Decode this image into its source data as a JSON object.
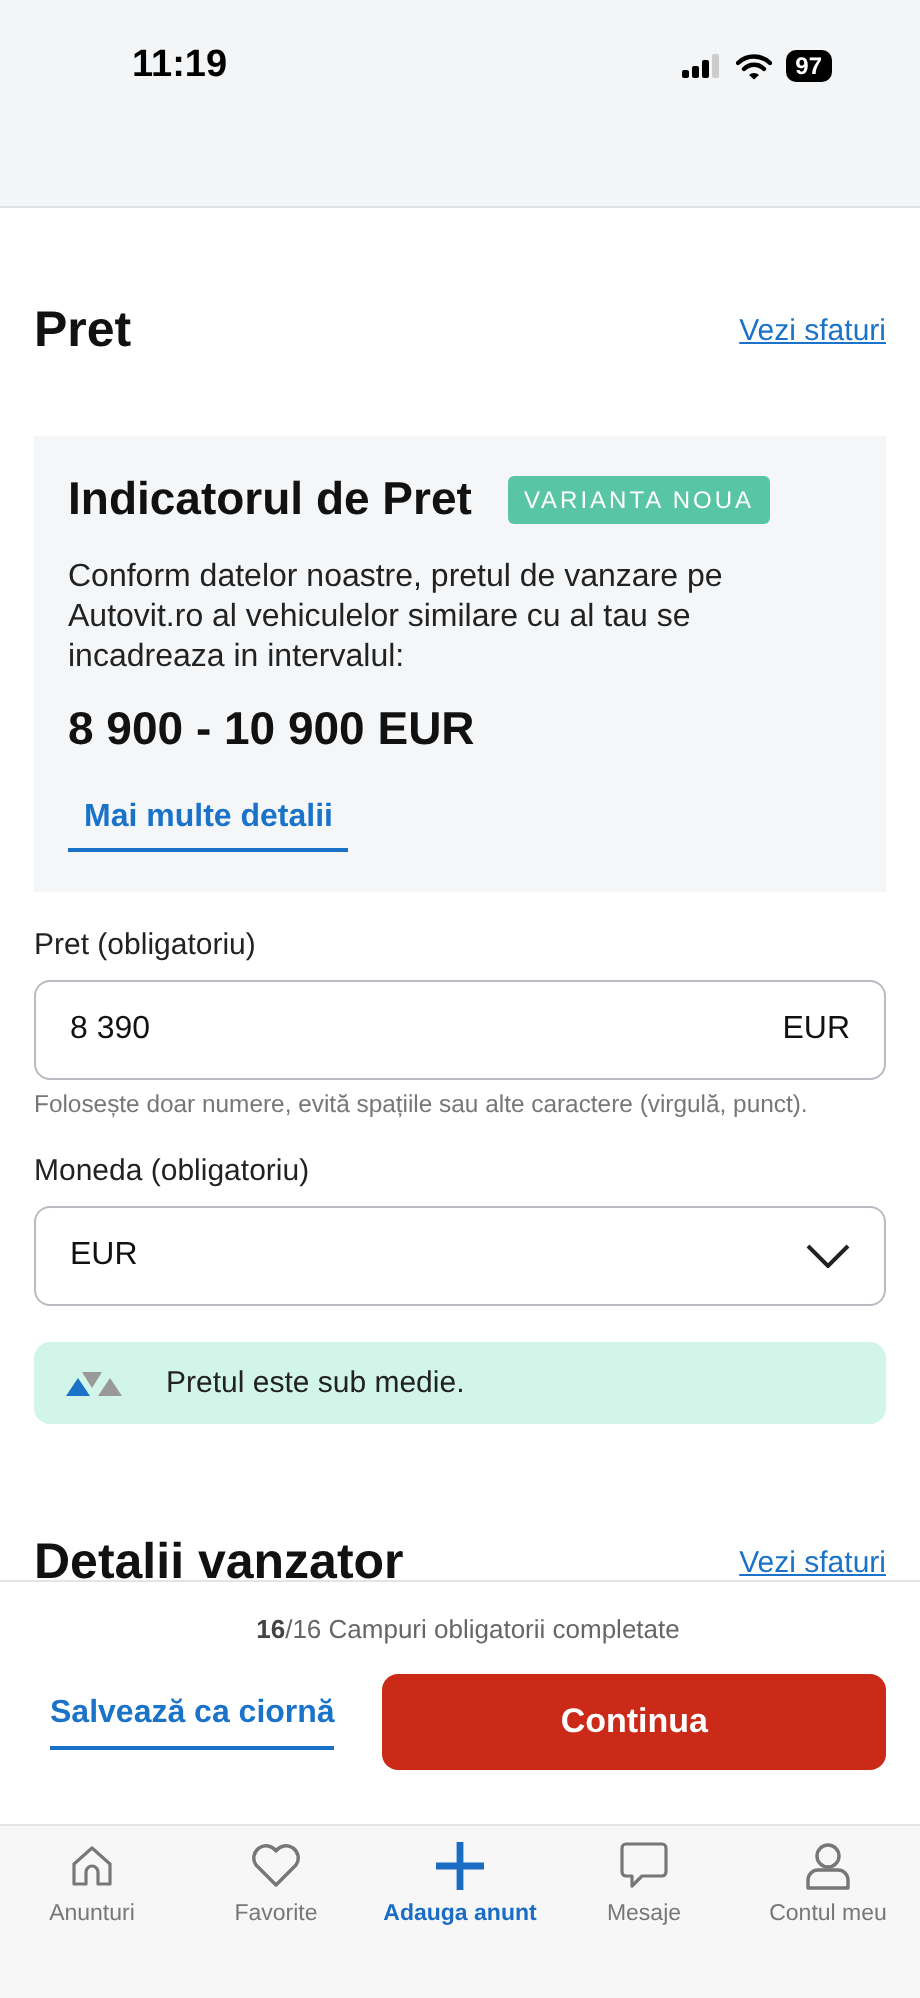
{
  "status_bar": {
    "time": "11:19",
    "battery": "97"
  },
  "section": {
    "title": "Pret",
    "link": "Vezi sfaturi"
  },
  "indicator": {
    "title": "Indicatorul de Pret",
    "badge": "VARIANTA NOUA",
    "description": "Conform datelor noastre, pretul de vanzare pe Autovit.ro al vehiculelor similare cu al tau se incadreaza in intervalul:",
    "range": "8 900 - 10 900 EUR",
    "details_link": "Mai multe detalii"
  },
  "price_field": {
    "label": "Pret (obligatoriu)",
    "value": "8 390",
    "suffix": "EUR",
    "hint": "Folosește doar numere, evită spațiile sau alte caractere (virgulă, punct)."
  },
  "currency_field": {
    "label": "Moneda (obligatoriu)",
    "value": "EUR"
  },
  "price_notice": "Pretul este sub medie.",
  "next_section": {
    "title": "Detalii vanzator",
    "link": "Vezi sfaturi"
  },
  "footer": {
    "progress": "**16**/16 Campuri obligatorii completate",
    "save": "Salvează ca ciornă",
    "continue": "Continua"
  },
  "nav": [
    {
      "kind": "home",
      "label": "Anunturi",
      "selected": false
    },
    {
      "kind": "heart",
      "label": "Favorite",
      "selected": false
    },
    {
      "kind": "plus",
      "label": "Adauga anunt",
      "selected": true
    },
    {
      "kind": "chat",
      "label": "Mesaje",
      "selected": false
    },
    {
      "kind": "user",
      "label": "Contul meu",
      "selected": false
    }
  ]
}
